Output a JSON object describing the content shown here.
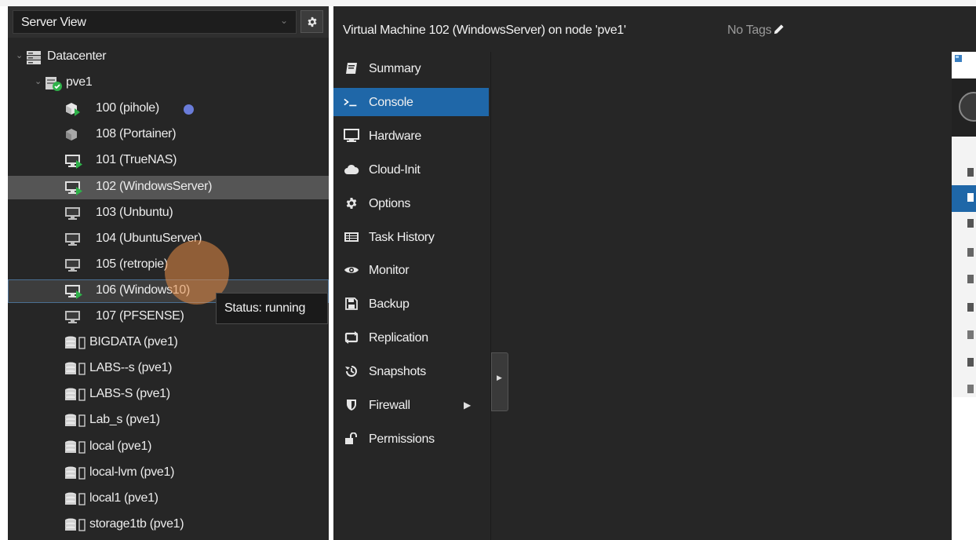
{
  "left_panel": {
    "view_selector": "Server View",
    "tree": [
      {
        "label": "Datacenter",
        "icon": "datacenter-icon",
        "indent": 0,
        "expanded": true
      },
      {
        "label": "pve1",
        "icon": "node-online-icon",
        "indent": 1,
        "expanded": true
      },
      {
        "label": "100 (pihole)",
        "icon": "container-running-icon",
        "indent": 2,
        "tag_color": "#6a7cd9"
      },
      {
        "label": "108 (Portainer)",
        "icon": "container-stopped-icon",
        "indent": 2
      },
      {
        "label": "101 (TrueNAS)",
        "icon": "vm-running-icon",
        "indent": 2
      },
      {
        "label": "102 (WindowsServer)",
        "icon": "vm-running-icon",
        "indent": 2,
        "selected": true
      },
      {
        "label": "103 (Unbuntu)",
        "icon": "vm-stopped-icon",
        "indent": 2
      },
      {
        "label": "104 (UbuntuServer)",
        "icon": "vm-stopped-icon",
        "indent": 2
      },
      {
        "label": "105 (retropie)",
        "icon": "vm-stopped-icon",
        "indent": 2
      },
      {
        "label": "106 (Windows10)",
        "icon": "vm-running-icon",
        "indent": 2,
        "hovered": true
      },
      {
        "label": "107 (PFSENSE)",
        "icon": "vm-stopped-icon",
        "indent": 2
      },
      {
        "label": "BIGDATA (pve1)",
        "icon": "storage-icon",
        "indent": 2
      },
      {
        "label": "LABS--s (pve1)",
        "icon": "storage-icon",
        "indent": 2
      },
      {
        "label": "LABS-S (pve1)",
        "icon": "storage-icon",
        "indent": 2
      },
      {
        "label": "Lab_s (pve1)",
        "icon": "storage-icon",
        "indent": 2
      },
      {
        "label": "local (pve1)",
        "icon": "storage-icon",
        "indent": 2
      },
      {
        "label": "local-lvm (pve1)",
        "icon": "storage-icon",
        "indent": 2
      },
      {
        "label": "local1 (pve1)",
        "icon": "storage-icon",
        "indent": 2
      },
      {
        "label": "storage1tb (pve1)",
        "icon": "storage-icon",
        "indent": 2
      }
    ]
  },
  "tooltip": {
    "text": "Status: running"
  },
  "header": {
    "title": "Virtual Machine 102 (WindowsServer) on node 'pve1'",
    "tags": "No Tags"
  },
  "nav": {
    "items": [
      {
        "label": "Summary",
        "icon": "summary-icon"
      },
      {
        "label": "Console",
        "icon": "console-icon",
        "active": true
      },
      {
        "label": "Hardware",
        "icon": "hardware-icon"
      },
      {
        "label": "Cloud-Init",
        "icon": "cloud-icon"
      },
      {
        "label": "Options",
        "icon": "gear-icon"
      },
      {
        "label": "Task History",
        "icon": "task-history-icon"
      },
      {
        "label": "Monitor",
        "icon": "eye-icon"
      },
      {
        "label": "Backup",
        "icon": "floppy-icon"
      },
      {
        "label": "Replication",
        "icon": "replication-icon"
      },
      {
        "label": "Snapshots",
        "icon": "history-icon"
      },
      {
        "label": "Firewall",
        "icon": "shield-icon",
        "has_submenu": true
      },
      {
        "label": "Permissions",
        "icon": "unlock-icon"
      }
    ]
  },
  "colors": {
    "panel_bg": "#262626",
    "accent": "#1f67a8",
    "running_green": "#2fb24a",
    "tag_blue": "#6a7cd9"
  }
}
